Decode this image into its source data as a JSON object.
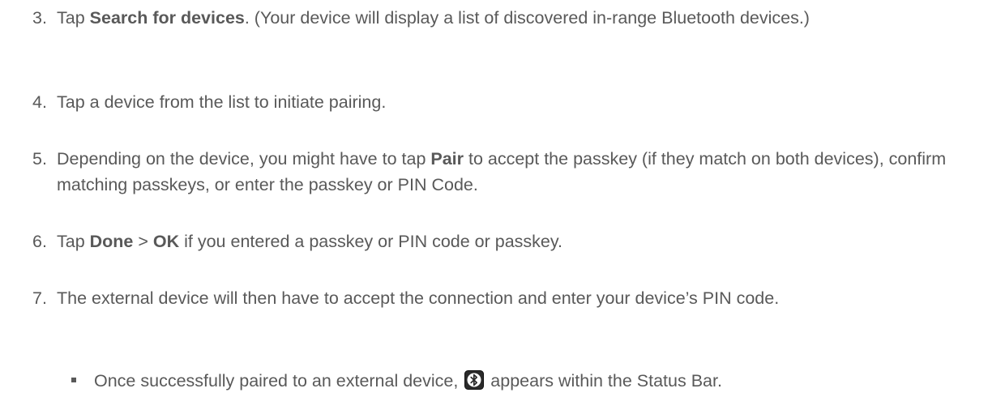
{
  "steps": [
    {
      "number": "3.",
      "prefix": "Tap ",
      "bold": "Search for devices",
      "suffix": ". (Your device will display a list of discovered in-range Bluetooth devices.)"
    },
    {
      "number": "4.",
      "text": "Tap a device from the list to initiate pairing."
    },
    {
      "number": "5.",
      "prefix": "Depending on the device, you might have to tap ",
      "bold": "Pair",
      "suffix": " to accept the passkey (if they match on both devices), confirm matching passkeys, or enter the passkey or PIN Code."
    },
    {
      "number": "6.",
      "prefix": "Tap ",
      "bold1": "Done",
      "middle": " > ",
      "bold2": "OK",
      "suffix": " if you entered a passkey or PIN code or passkey."
    },
    {
      "number": "7.",
      "text": "The external device will then have to accept the connection and enter your device’s PIN code."
    }
  ],
  "sub_bullet": {
    "before": "Once successfully paired to an external device, ",
    "icon": "bluetooth-icon",
    "after": " appears within the Status Bar."
  },
  "colors": {
    "text": "#595959",
    "icon_bg": "#2b2b2b",
    "icon_fg": "#ffffff"
  }
}
